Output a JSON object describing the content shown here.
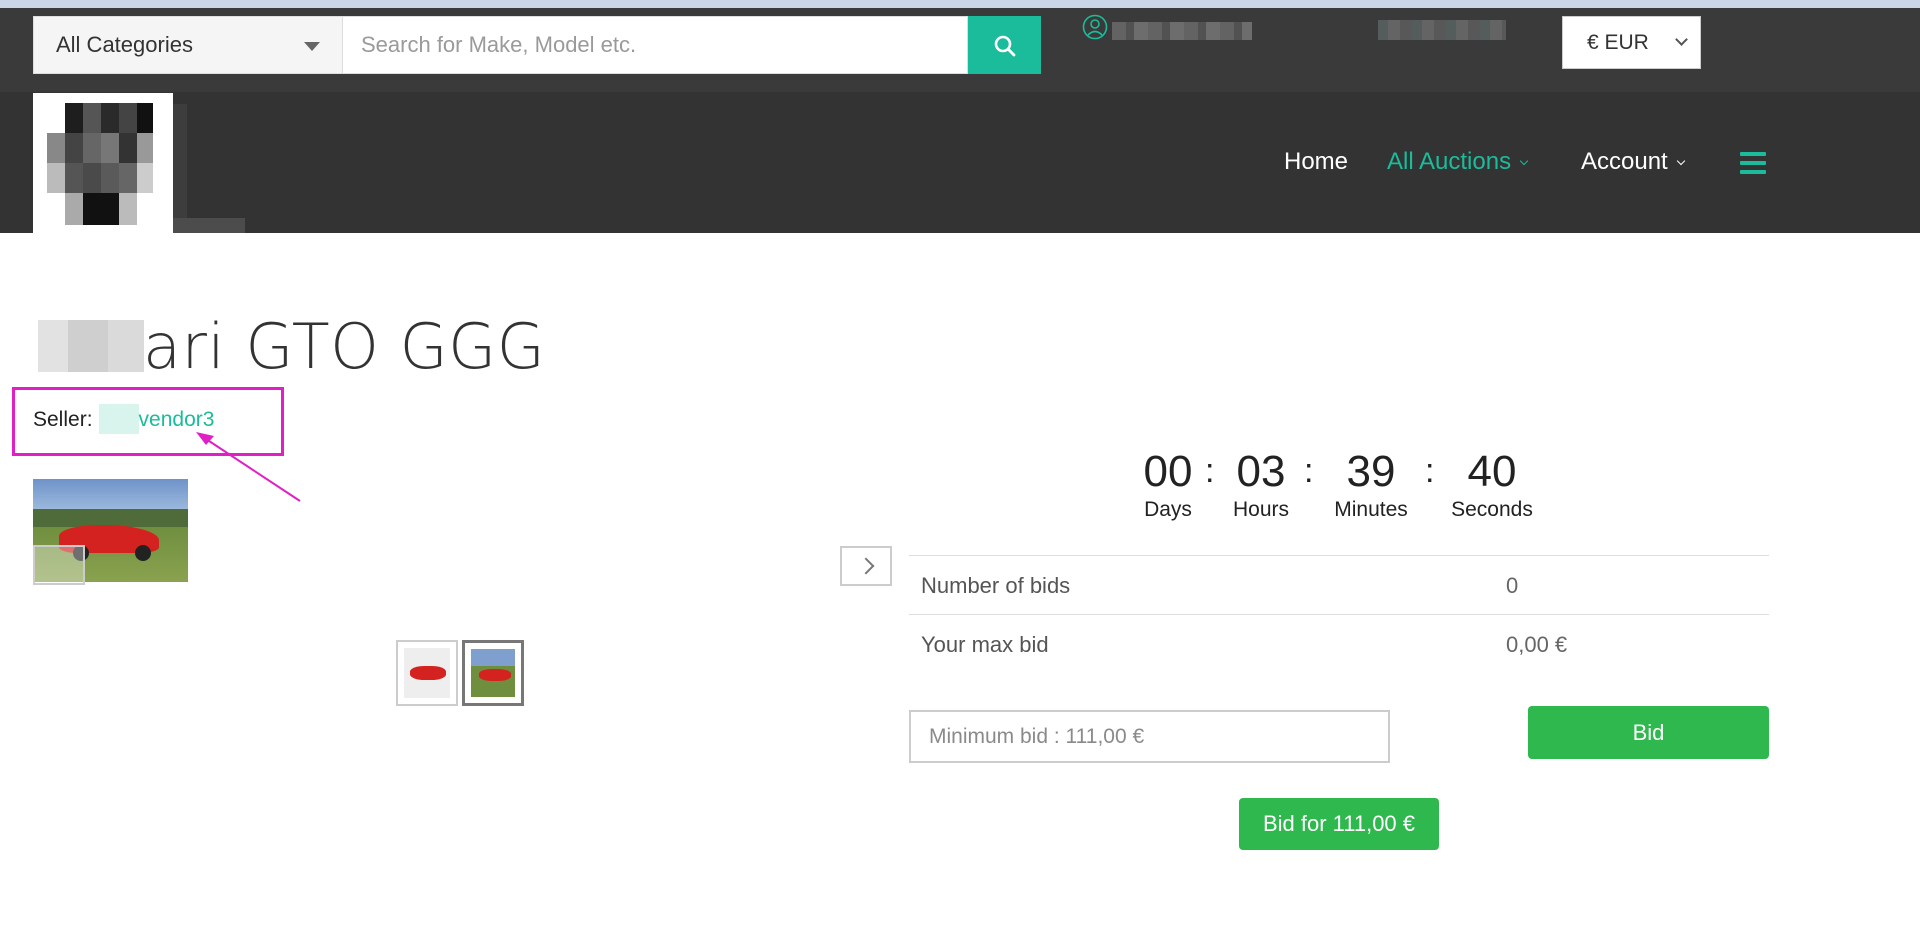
{
  "header": {
    "category_select": "All Categories",
    "search_placeholder": "Search for Make, Model etc.",
    "currency": "€ EUR"
  },
  "nav": {
    "home": "Home",
    "all_auctions": "All Auctions",
    "account": "Account"
  },
  "listing": {
    "title": "ari GTO GGG",
    "seller_label": "Seller:",
    "seller_name": "vendor3"
  },
  "countdown": {
    "days": "00",
    "hours": "03",
    "minutes": "39",
    "seconds": "40",
    "days_label": "Days",
    "hours_label": "Hours",
    "minutes_label": "Minutes",
    "seconds_label": "Seconds",
    "separator": ":"
  },
  "bid_info": {
    "rows": [
      {
        "label": "Number of bids",
        "value": "0"
      },
      {
        "label": "Your max bid",
        "value": "0,00 €"
      }
    ],
    "input_placeholder": "Minimum bid : 111,00 €",
    "bid_button": "Bid",
    "bid_for_button": "Bid for 111,00 €"
  },
  "colors": {
    "accent": "#1bbc9b",
    "bid_green": "#2eb84e",
    "annotation": "#e01fc6",
    "navbar_bg": "#333333"
  }
}
